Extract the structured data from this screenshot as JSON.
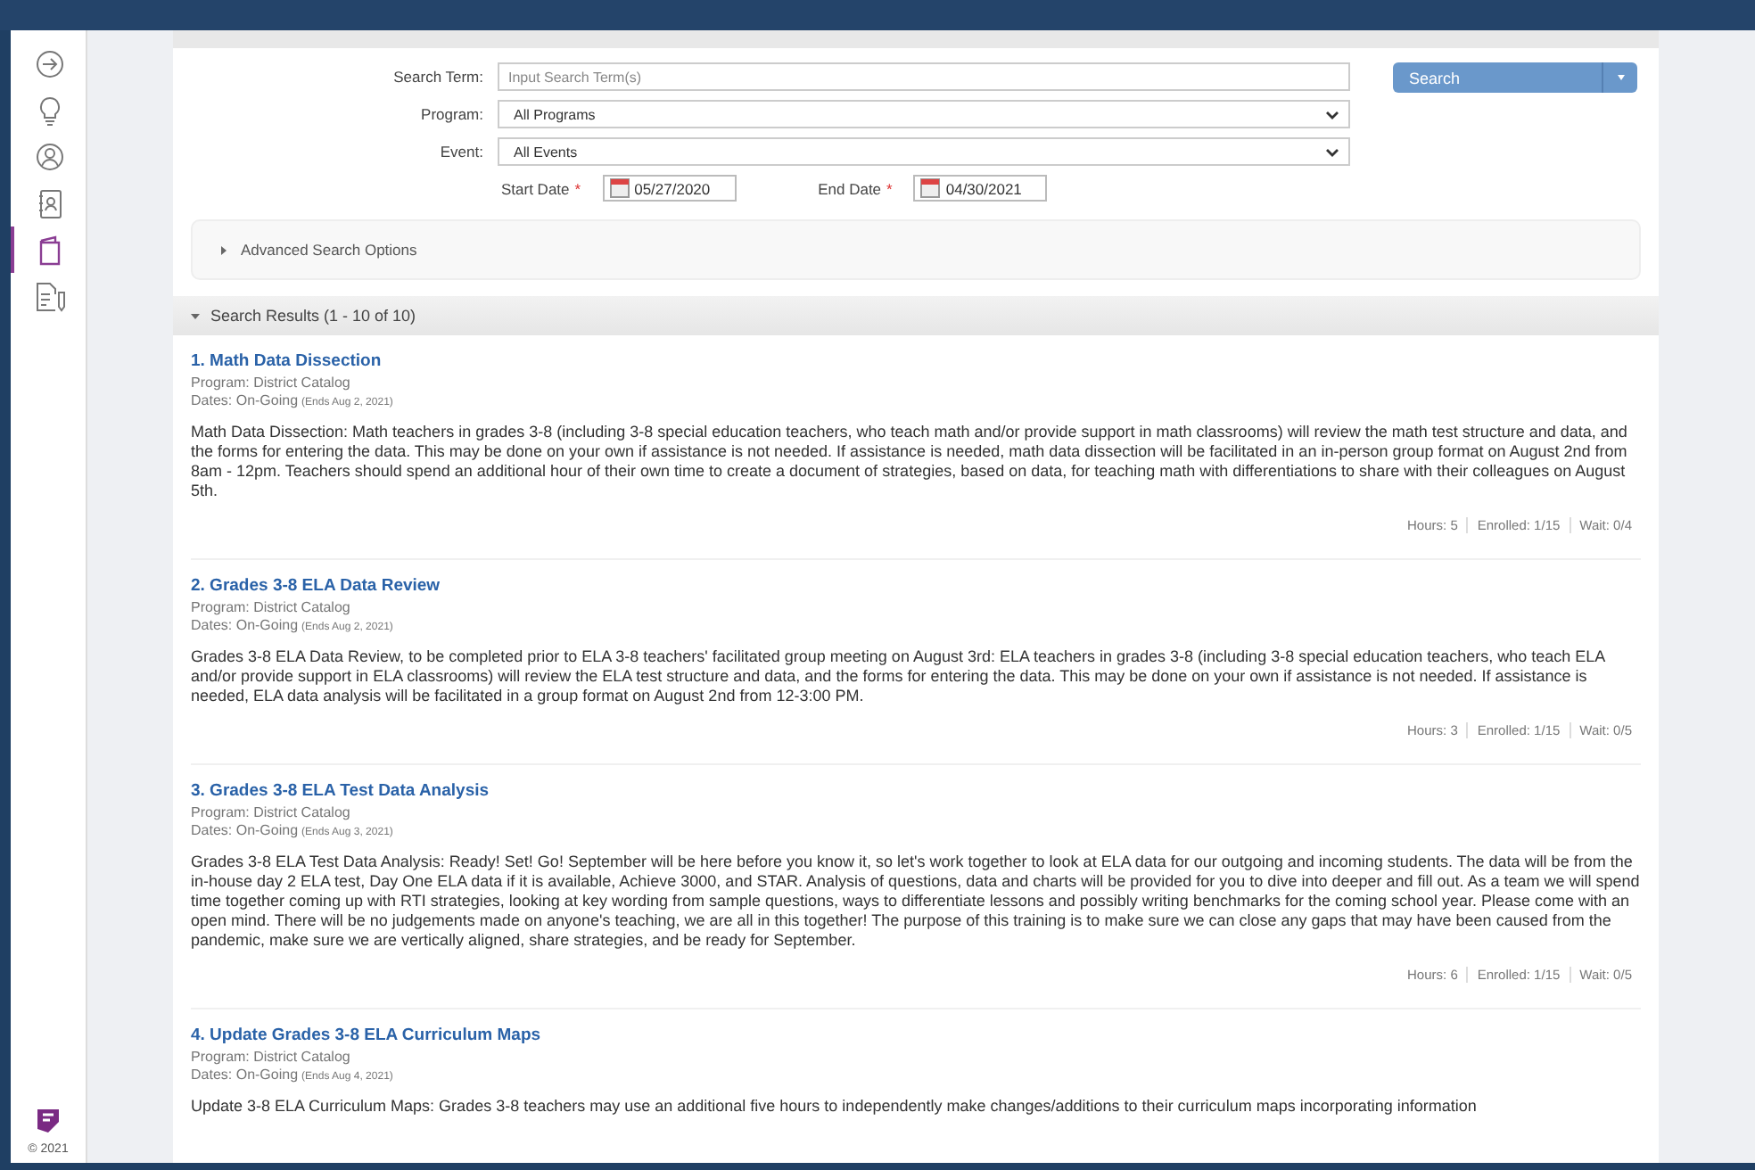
{
  "sidebar": {
    "items": [
      {
        "kind": "arrow",
        "selected": false
      },
      {
        "kind": "bulb",
        "selected": false
      },
      {
        "kind": "user",
        "selected": false
      },
      {
        "kind": "contact",
        "selected": false
      },
      {
        "kind": "book",
        "selected": true
      },
      {
        "kind": "doc",
        "selected": false
      }
    ],
    "copyright": "© 2021"
  },
  "search_form": {
    "search_term": {
      "label": "Search Term:",
      "placeholder": "Input Search Term(s)"
    },
    "program": {
      "label": "Program:",
      "value": "All Programs"
    },
    "event": {
      "label": "Event:",
      "value": "All Events"
    },
    "start_date": {
      "label": "Start Date",
      "required": "*",
      "value": "05/27/2020"
    },
    "end_date": {
      "label": "End Date",
      "required": "*",
      "value": "04/30/2021"
    },
    "search_button": "Search",
    "advanced": {
      "label": "Advanced Search Options",
      "expanded": false
    }
  },
  "results": {
    "header": "Search Results (1 - 10 of 10)",
    "expanded": true,
    "items": [
      {
        "title": "1. Math Data Dissection",
        "program": "Program: District Catalog",
        "dates": "Dates: On-Going",
        "ends": "(Ends Aug 2, 2021)",
        "description": "Math Data Dissection: Math teachers in grades 3-8 (including 3-8 special education teachers, who teach math and/or provide support in math classrooms) will review the math test structure and data, and the forms for entering the data. This may be done on your own if assistance is not needed. If assistance is needed, math data dissection will be facilitated in an in-person group format on August 2nd from 8am - 12pm. Teachers should spend an additional hour of their own time to create a document of strategies, based on data, for teaching math with differentiations to share with their colleagues on August 5th.",
        "hours": "Hours: 5",
        "enrolled": "Enrolled: 1/15",
        "wait": "Wait: 0/4"
      },
      {
        "title": "2. Grades 3-8 ELA Data Review",
        "program": "Program: District Catalog",
        "dates": "Dates: On-Going",
        "ends": "(Ends Aug 2, 2021)",
        "description": "Grades 3-8 ELA Data Review, to be completed prior to ELA 3-8 teachers' facilitated group meeting on August 3rd: ELA teachers in grades 3-8 (including 3-8 special education teachers, who teach ELA and/or provide support in ELA classrooms) will review the ELA test structure and data, and the forms for entering the data. This may be done on your own if assistance is not needed. If assistance is needed, ELA data analysis will be facilitated in a group format on August 2nd from 12-3:00 PM.",
        "hours": "Hours: 3",
        "enrolled": "Enrolled: 1/15",
        "wait": "Wait: 0/5"
      },
      {
        "title": "3. Grades 3-8 ELA Test Data Analysis",
        "program": "Program: District Catalog",
        "dates": "Dates: On-Going",
        "ends": "(Ends Aug 3, 2021)",
        "description": "Grades 3-8 ELA Test Data Analysis: Ready! Set! Go! September will be here before you know it, so let's work together to look at ELA data for our outgoing and incoming students. The data will be from the in-house day 2 ELA test, Day One ELA data if it is available, Achieve 3000, and STAR. Analysis of questions, data and charts will be provided for you to dive into deeper and fill out. As a team we will spend time together coming up with RTI strategies, looking at key wording from sample questions, ways to differentiate lessons and possibly writing benchmarks for the coming school year. Please come with an open mind. There will be no judgements made on anyone's teaching, we are all in this together! The purpose of this training is to make sure we can close any gaps that may have been caused from the pandemic, make sure we are vertically aligned, share strategies, and be ready for September.",
        "hours": "Hours: 6",
        "enrolled": "Enrolled: 1/15",
        "wait": "Wait: 0/5"
      },
      {
        "title": "4. Update Grades 3-8 ELA Curriculum Maps",
        "program": "Program: District Catalog",
        "dates": "Dates: On-Going",
        "ends": "(Ends Aug 4, 2021)",
        "description": "Update 3-8 ELA Curriculum Maps: Grades 3-8 teachers may use an additional five hours to independently make changes/additions to their curriculum maps incorporating information"
      }
    ]
  }
}
